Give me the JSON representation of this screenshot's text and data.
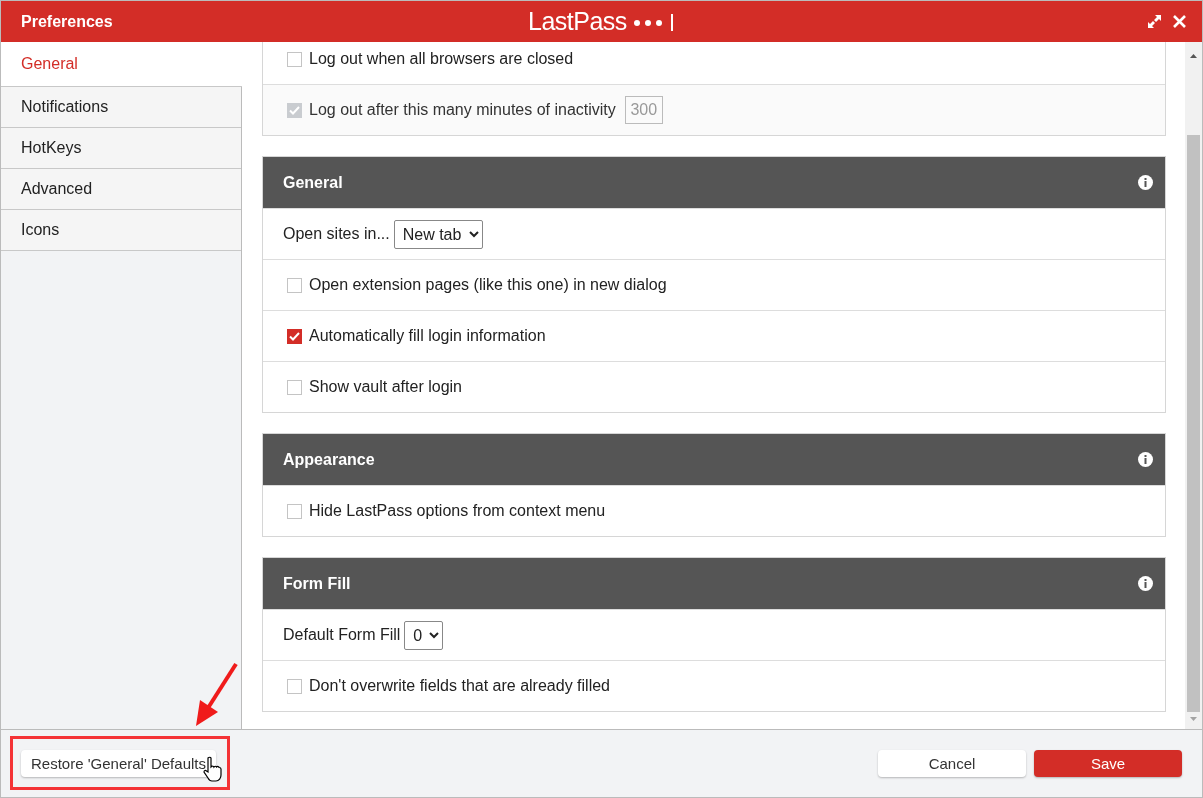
{
  "window": {
    "title": "Preferences",
    "brand": "LastPass"
  },
  "sidebar": {
    "items": [
      {
        "label": "General",
        "selected": true
      },
      {
        "label": "Notifications",
        "selected": false
      },
      {
        "label": "HotKeys",
        "selected": false
      },
      {
        "label": "Advanced",
        "selected": false
      },
      {
        "label": "Icons",
        "selected": false
      }
    ]
  },
  "sections": [
    {
      "rows": [
        {
          "kind": "checkbox",
          "label": "Log out when all browsers are closed",
          "checked": false,
          "disabled": false
        },
        {
          "kind": "checkbox",
          "label": "Log out after this many minutes of inactivity",
          "checked": true,
          "disabled": true,
          "value": "300"
        }
      ]
    },
    {
      "title": "General",
      "rows": [
        {
          "kind": "select",
          "label": "Open sites in...",
          "value": "New tab"
        },
        {
          "kind": "checkbox",
          "label": "Open extension pages (like this one) in new dialog",
          "checked": false,
          "disabled": false
        },
        {
          "kind": "checkbox",
          "label": "Automatically fill login information",
          "checked": true,
          "disabled": false
        },
        {
          "kind": "checkbox",
          "label": "Show vault after login",
          "checked": false,
          "disabled": false
        }
      ]
    },
    {
      "title": "Appearance",
      "rows": [
        {
          "kind": "checkbox",
          "label": "Hide LastPass options from context menu",
          "checked": false,
          "disabled": false
        }
      ]
    },
    {
      "title": "Form Fill",
      "rows": [
        {
          "kind": "select",
          "label": "Default Form Fill",
          "value": "0"
        },
        {
          "kind": "checkbox",
          "label": "Don't overwrite fields that are already filled",
          "checked": false,
          "disabled": false
        }
      ]
    }
  ],
  "footer": {
    "restore_button": "Restore 'General' Defaults",
    "cancel_button": "Cancel",
    "save_button": "Save"
  }
}
